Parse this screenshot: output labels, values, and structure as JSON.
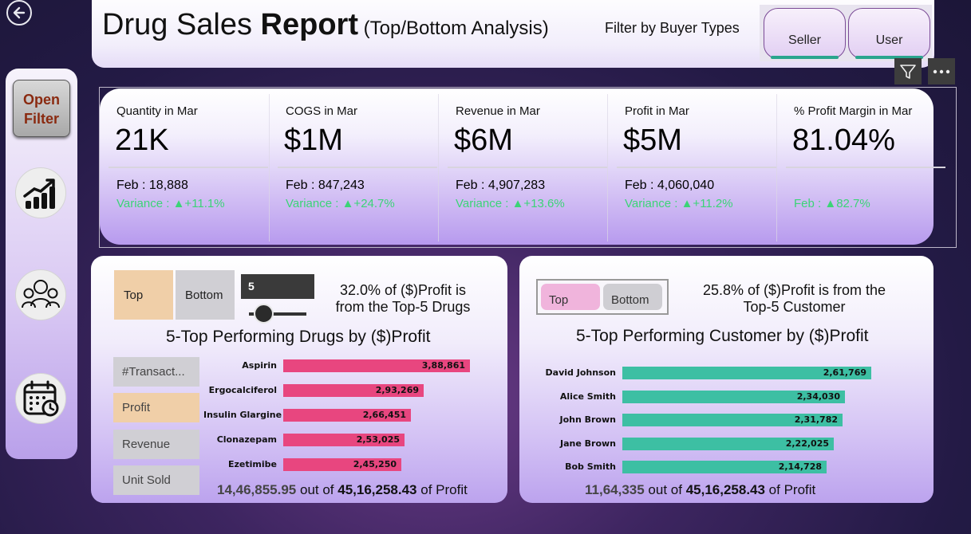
{
  "header": {
    "title_main": "Drug Sales ",
    "title_bold": "Report",
    "title_sub": " (Top/Bottom Analysis)",
    "filter_label": "Filter by Buyer Types",
    "slicer": [
      "Seller",
      "User"
    ]
  },
  "sidebar": {
    "open_filter": [
      "Open",
      "Filter"
    ]
  },
  "kpis": [
    {
      "label": "Quantity in Mar",
      "value": "21K",
      "prev": "Feb : 18,888",
      "variance": "Variance : ▲+11.1%"
    },
    {
      "label": "COGS in Mar",
      "value": "$1M",
      "prev": "Feb : 847,243",
      "variance": "Variance : ▲+24.7%"
    },
    {
      "label": "Revenue in Mar",
      "value": "$6M",
      "prev": "Feb : 4,907,283",
      "variance": "Variance : ▲+13.6%"
    },
    {
      "label": "Profit in Mar",
      "value": "$5M",
      "prev": "Feb : 4,060,040",
      "variance": "Variance : ▲+11.2%"
    },
    {
      "label": "% Profit Margin in Mar",
      "value": "81.04%",
      "prev": "",
      "variance": "Feb : ▲82.7%"
    }
  ],
  "drugs_panel": {
    "toggle_top": "Top",
    "toggle_bottom": "Bottom",
    "n_value": "5",
    "n_slider_fraction": 0.15,
    "share_line1": "32.0% of ($)Profit is",
    "share_line2": "from the Top-5 Drugs",
    "chart_title": "5-Top Performing Drugs by ($)Profit",
    "metrics": [
      "#Transact...",
      "Profit",
      "Revenue",
      "Unit Sold"
    ],
    "selected_metric": "Profit",
    "footer_part": "14,46,855.95",
    "footer_mid": " out of ",
    "footer_total": "45,16,258.43",
    "footer_end": " of Profit"
  },
  "customers_panel": {
    "toggle_top": "Top",
    "toggle_bottom": "Bottom",
    "share_line1": "25.8% of ($)Profit is from the",
    "share_line2": "Top-5 Customer",
    "chart_title": "5-Top Performing Customer by ($)Profit",
    "footer_part": "11,64,335",
    "footer_mid": " out of ",
    "footer_total": "45,16,258.43",
    "footer_end": " of Profit"
  },
  "chart_data": [
    {
      "type": "bar",
      "orientation": "horizontal",
      "title": "5-Top Performing Drugs by ($)Profit",
      "categories": [
        "Aspirin",
        "Ergocalciferol",
        "Insulin Glargine",
        "Clonazepam",
        "Ezetimibe"
      ],
      "values": [
        388861,
        293269,
        266451,
        253025,
        245250
      ],
      "value_labels": [
        "3,88,861",
        "2,93,269",
        "2,66,451",
        "2,53,025",
        "2,45,250"
      ],
      "color": "#e8467f"
    },
    {
      "type": "bar",
      "orientation": "horizontal",
      "title": "5-Top Performing Customer by ($)Profit",
      "categories": [
        "David Johnson",
        "Alice Smith",
        "John Brown",
        "Jane Brown",
        "Bob Smith"
      ],
      "values": [
        261769,
        234030,
        231782,
        222025,
        214728
      ],
      "value_labels": [
        "2,61,769",
        "2,34,030",
        "2,31,782",
        "2,22,025",
        "2,14,728"
      ],
      "color": "#3dbfa3"
    }
  ],
  "colors": {
    "variance_green": "#3cd477",
    "toggle_top_drugs": "#f0cfa8",
    "toggle_top_customers": "#f0b4dc",
    "slicer_underline": "#2aa58e"
  }
}
